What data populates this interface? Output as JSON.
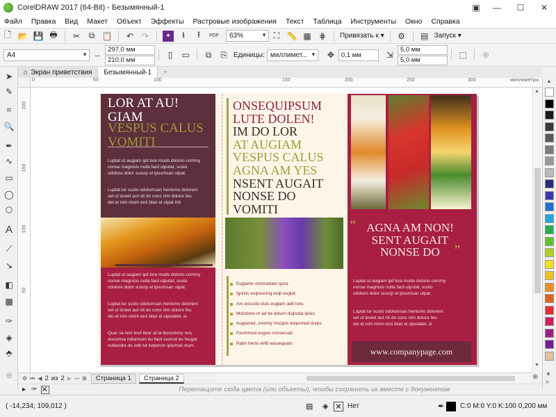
{
  "window": {
    "title": "CorelDRAW 2017 (64-Bit) - Безымянный-1"
  },
  "menu": [
    "Файл",
    "Правка",
    "Вид",
    "Макет",
    "Объект",
    "Эффекты",
    "Растровые изображения",
    "Текст",
    "Таблица",
    "Инструменты",
    "Окно",
    "Справка"
  ],
  "toolbar": {
    "zoom": "63%",
    "snap_label": "Привязать к",
    "launch_label": "Запуск"
  },
  "propbar": {
    "page_size": "A4",
    "width": "297,0 мм",
    "height": "210,0 мм",
    "units_label": "Единицы:",
    "units_value": "миллимет...",
    "nudge": "0,1 мм",
    "dup_x": "5,0 мм",
    "dup_y": "5,0 мм"
  },
  "doc_tabs": [
    "Экран приветствия",
    "Безымянный-1"
  ],
  "ruler": {
    "top_ticks": [
      "0",
      "50",
      "100",
      "150",
      "200",
      "250",
      "300"
    ],
    "units": "миллиметры",
    "left_ticks": [
      "200",
      "150",
      "100",
      "50"
    ]
  },
  "brochure": {
    "p1_heading_white": [
      "LOR AT AU!",
      "GIAM"
    ],
    "p1_heading_olive": [
      "VESPUS CALUS",
      "VOMITI"
    ],
    "p1_body1": [
      "Luptat ut augiam ipit lore modo dolorio commy",
      "nonse magnisis nulla facil ulputat, susto",
      "odolore dolor suscip el ipsumsan utpat."
    ],
    "p1_body2": [
      "Luptat lor susto odolumsan henismo dolorem",
      "vel ut loreet aut nit do cons nim dolore feu",
      "del et nim nisim erci blan el utpat iriit."
    ],
    "p1_bottom1": [
      "Luptat ut augiam ipit lore modo dolorio commy",
      "nonse magnisis nulla facil ulputat, susto",
      "odolore dolor suscip el ipsumsan utpat."
    ],
    "p1_bottom2": [
      "Luptat lor susto odolumsan henismo dolorem",
      "vel ut loreet aut nit do cons nim dolore feu",
      "dio et nim nisim erci blan el ulputatet, si."
    ],
    "p1_bottom3": [
      "Quer se tem incil tioor at la feccummy nos",
      "accumsa ndiamcon eu facil iustrud eu feugat",
      "nullandre do odit lut lorpercin ipismod olum."
    ],
    "p2_heading_wine": [
      "ONSEQUIPSUM",
      "LUTE DOLEN!"
    ],
    "p2_heading_dark1": [
      "IM DO LOR"
    ],
    "p2_heading_olive": [
      "AT AUGIAM",
      "VESPUS CALUS",
      "AGNA AM YES"
    ],
    "p2_heading_dark2": [
      "NSENT AUGAIT",
      "NONSE DO",
      "VOMITI"
    ],
    "p2_bullets": [
      "Eugiamc ommodiam quisi.",
      "Ignisis euipsucing eulp eugiat.",
      "Am ectustie duis eugiam adit lore.",
      "Molobore m ad tie dolum dulputat ipisis.",
      "Augiamet, commy niscipis duipsmod duips.",
      "Feummod eugue consecuat.",
      "Ratin henis erillt wissequam."
    ],
    "p3_quote": [
      "AGNA AM NON!",
      "SENT AUGAIT",
      "NONSE DO"
    ],
    "p3_body1": [
      "Luptat ut augiam ipit lore modo dolorio commy",
      "nonse magnisis nulla facil ulputat, susto",
      "odolore dolor suscip el ipsumsan utpat."
    ],
    "p3_body2": [
      "Luptat lor susto odolumsan henismo dolorem",
      "vel ut loreet aut nit do cons nim dolore feu",
      "dio et nim nisim erci blan el ulputatet, si."
    ],
    "website": "www.companypage.com"
  },
  "pages": {
    "current": "2",
    "of_label": "из",
    "total": "2",
    "tabs": [
      "Страница 1",
      "Страница 2"
    ]
  },
  "hint": "Перетащите сюда цвета (или объекты), чтобы сохранить их вместе с документом",
  "status": {
    "coords": "( -14,234; 109,012 )",
    "fill": "Нет",
    "outline": "C:0 M:0 Y:0 K:100  0,200 мм"
  },
  "palette_colors": [
    "#ffffff",
    "#000000",
    "#1a1a1a",
    "#3a3a3a",
    "#5a5a5a",
    "#7a7a7a",
    "#9a9a9a",
    "#bababa",
    "#2a2a7a",
    "#3a3ab0",
    "#2070d0",
    "#20a8e0",
    "#20b050",
    "#60c030",
    "#b0d020",
    "#f0e020",
    "#f0c020",
    "#f09020",
    "#e06020",
    "#e03030",
    "#d02060",
    "#a02080",
    "#702090",
    "#e0c0a0"
  ],
  "colors": {
    "wine": "#a81f43",
    "plum": "#5e2f3c",
    "olive": "#a19a3a",
    "cream": "#fdf6e8"
  }
}
